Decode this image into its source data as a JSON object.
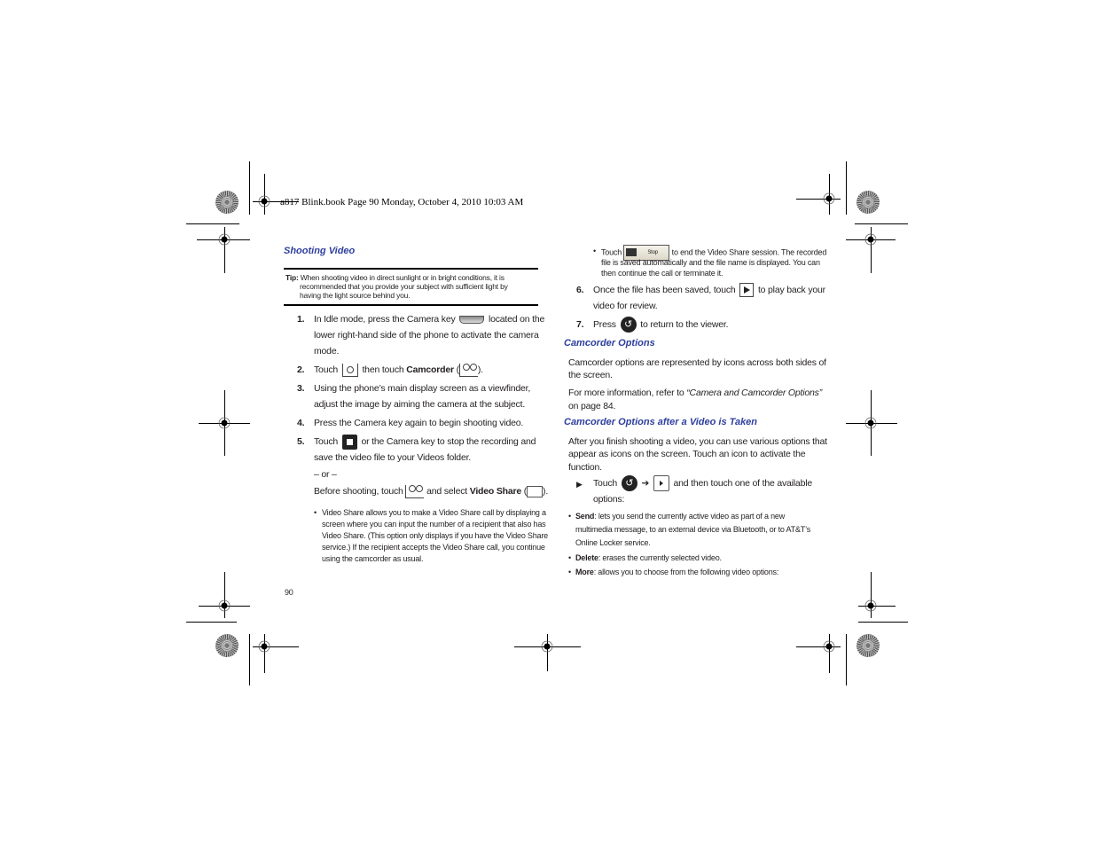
{
  "header_stamp": "a817 Blink.book  Page 90  Monday, October 4, 2010  10:03 AM",
  "page_number": "90",
  "left": {
    "heading": "Shooting Video",
    "tip": {
      "label": "Tip:",
      "line1": "When shooting video in direct sunlight or in bright conditions, it is",
      "line2": "recommended that you provide your subject with sufficient light by",
      "line3": "having the light source behind you."
    },
    "steps": [
      {
        "num": "1.",
        "a": "In Idle mode, press the Camera key",
        "b": "located on the",
        "line2": "lower right-hand side of the phone to activate the camera",
        "line3": "mode."
      },
      {
        "num": "2.",
        "a": "Touch",
        "b": "then touch",
        "bold": "Camcorder",
        "c": "(",
        "d": ")."
      },
      {
        "num": "3.",
        "line1": "Using the phone’s main display screen as a viewfinder,",
        "line2": "adjust the image by aiming the camera at the subject."
      },
      {
        "num": "4.",
        "line1": "Press the Camera key again to begin shooting video."
      },
      {
        "num": "5.",
        "a": "Touch",
        "b": "or the Camera key to stop the recording and",
        "line2": "save the video file to your Videos folder."
      }
    ],
    "or": "– or –",
    "before": {
      "a": "Before shooting, touch",
      "b": "and select",
      "bold": "Video Share",
      "c": "(",
      "d": ")."
    },
    "bullet": {
      "line1": "Video Share allows you to make a Video Share call by displaying a",
      "line2": "screen where you can input the number of a recipient that also has",
      "line3": "Video Share. (This option only displays if you have the Video Share",
      "line4": "service.) If the recipient accepts the Video Share call, you continue",
      "line5": "using the camcorder as usual."
    }
  },
  "right": {
    "bullet_stop": {
      "a": "Touch",
      "icon_label": "Stop",
      "b": "to end the Video Share session. The recorded",
      "line2": "file is saved automatically and the file name is displayed. You can",
      "line3": "then continue the call or terminate it."
    },
    "step6": {
      "num": "6.",
      "a": "Once the file has been saved, touch",
      "b": "to play back your",
      "line2": "video for review."
    },
    "step7": {
      "num": "7.",
      "a": "Press",
      "b": "to return to the viewer."
    },
    "h_options": "Camcorder Options",
    "options_p1_l1": "Camcorder options are represented by icons across both sides of",
    "options_p1_l2": "the screen.",
    "options_p2_a": "For more information, refer to",
    "options_p2_ref": "“Camera and Camcorder Options”",
    "options_p2_l2": "on page 84.",
    "h_after": "Camcorder Options after a Video is Taken",
    "after_l1": "After you finish shooting a video, you can use various options that",
    "after_l2": "appear as icons on the screen. Touch an icon to activate the",
    "after_l3": "function.",
    "touch_line": {
      "a": "Touch",
      "arrow": "➔",
      "b": "and then touch one of the available",
      "line2": "options:"
    },
    "bullets": [
      {
        "bold": "Send",
        "rest": ": lets you send the currently active video as part of a new",
        "line2": "multimedia message, to an external device via Bluetooth, or to AT&T’s",
        "line3": "Online Locker service."
      },
      {
        "bold": "Delete",
        "rest": ": erases the currently selected video."
      },
      {
        "bold": "More",
        "rest": ": allows you to choose from the following video options:"
      }
    ]
  }
}
